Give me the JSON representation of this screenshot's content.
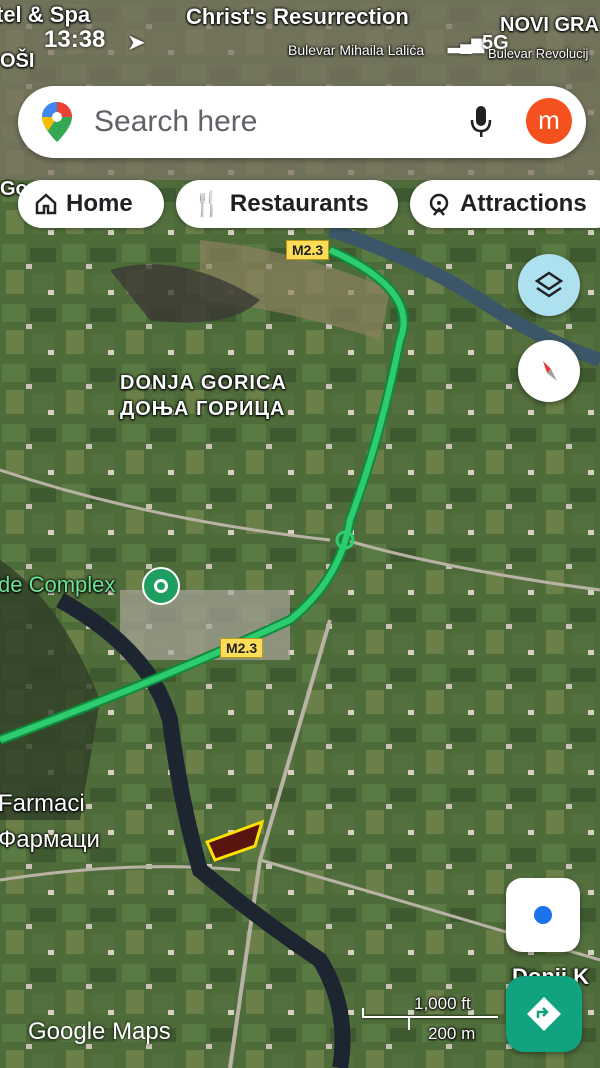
{
  "status_bar": {
    "time": "13:38",
    "network": "5G"
  },
  "search": {
    "placeholder": "Search here",
    "avatar_letter": "m"
  },
  "chips": [
    {
      "label": "Home",
      "icon": "home-icon"
    },
    {
      "label": "Restaurants",
      "icon": "fork-knife-icon"
    },
    {
      "label": "Attractions",
      "icon": "attractions-icon"
    }
  ],
  "map_labels": {
    "top_left_partial": "tel & Spa",
    "christs_resurrection": "Christ's Resurrection",
    "novi_grad_partial": "NOVI GRA",
    "bulevar_mihaila": "Bulevar Mihaila Lalića",
    "bulevar_revolucije": "Bulevar Revolucij",
    "dosi_partial": "OŠI",
    "gorica_partial": "Go",
    "donja_gorica_latin": "DONJA GORICA",
    "donja_gorica_cyrillic": "ДОЊА ГОРИЦА",
    "complex_partial": "de Complex",
    "farmaci_latin": "Farmaci",
    "farmaci_cyrillic": "Фармаци",
    "donji_partial": "Donji K",
    "road_m23_top": "M2.3",
    "road_m23_bottom": "M2.3"
  },
  "scale": {
    "imperial": "1,000 ft",
    "metric": "200 m"
  },
  "brand": {
    "google": "Google",
    "maps": "Maps"
  },
  "colors": {
    "route": "#2ecc71",
    "route_outline": "#0f8a3c",
    "parcel_fill": "#5a1410",
    "parcel_border": "#ffe100",
    "avatar": "#f4511e",
    "location_dot": "#1a73e8",
    "directions": "#11a37f"
  }
}
